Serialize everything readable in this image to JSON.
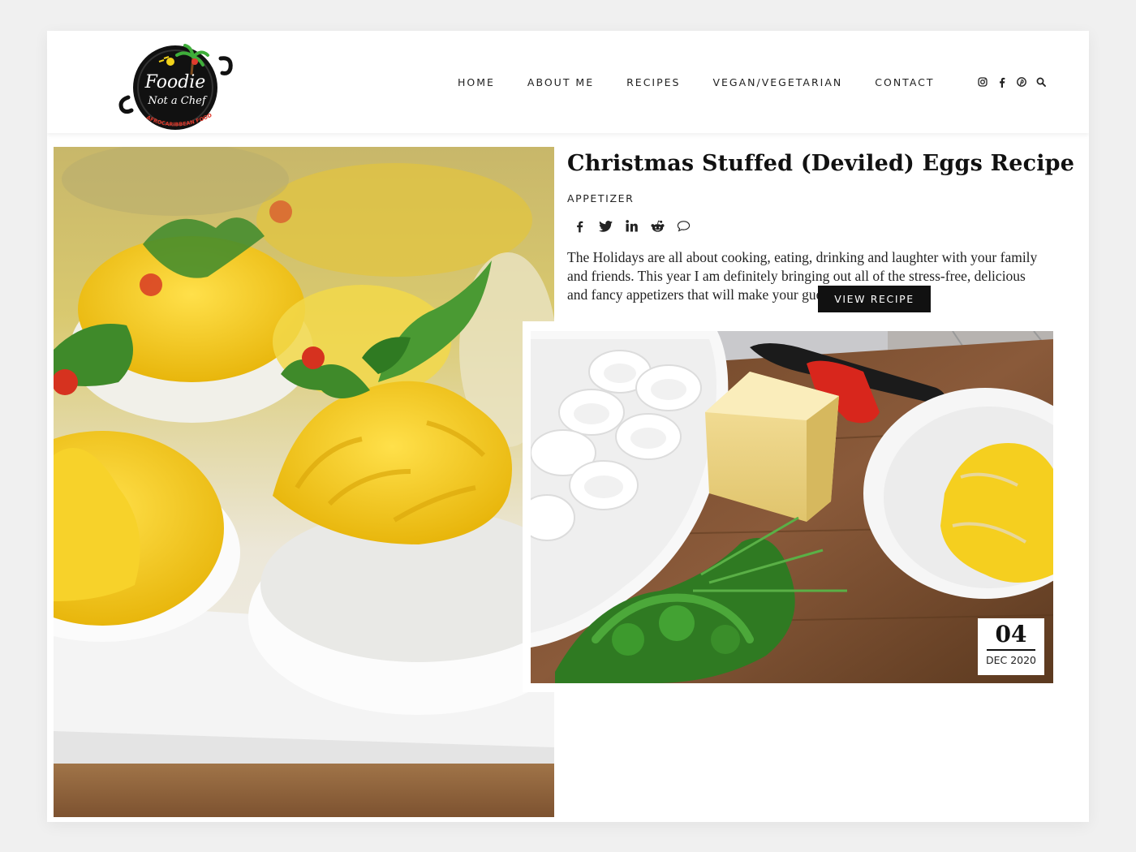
{
  "brand": {
    "logo_line1": "Foodie",
    "logo_line2": "Not a Chef",
    "logo_tagline": "AFROCARIBBEAN FOOD BLOG"
  },
  "nav": {
    "items": [
      "HOME",
      "ABOUT ME",
      "RECIPES",
      "VEGAN/VEGETARIAN",
      "CONTACT"
    ]
  },
  "header_icons": [
    "instagram-icon",
    "facebook-icon",
    "pinterest-icon",
    "search-icon"
  ],
  "post": {
    "title": "Christmas Stuffed (Deviled) Eggs Recipe",
    "category": "APPETIZER",
    "share_icons": [
      "facebook-icon",
      "twitter-icon",
      "linkedin-icon",
      "reddit-icon",
      "comment-icon"
    ],
    "excerpt": "The Holidays are all about cooking, eating, drinking and laughter with your family and friends. This year I am definitely bringing out all of the stress-free, delicious and fancy appetizers that will make your guests...",
    "button_label": "VIEW RECIPE",
    "date_day": "04",
    "date_month_year": "DEC 2020"
  },
  "colors": {
    "accent": "#111111",
    "yolk": "#f5cf1f",
    "parsley": "#3f8a2a",
    "cutting_board": "#8a5a3a"
  }
}
